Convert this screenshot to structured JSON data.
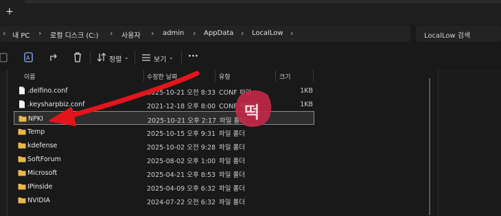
{
  "tabbar": {
    "new_tab": "+"
  },
  "address": {
    "breadcrumbs": [
      "내 PC",
      "로컬 디스크 (C:)",
      "사용자",
      "admin",
      "AppData",
      "LocalLow"
    ]
  },
  "search": {
    "placeholder": "LocalLow 검색"
  },
  "toolbar": {
    "sort_label": "정렬",
    "view_label": "보기",
    "more_label": "···"
  },
  "columns": {
    "name": "이름",
    "date": "수정한 날짜",
    "type": "유형",
    "size": "크기"
  },
  "files": [
    {
      "name": ".delfino.conf",
      "date": "2025-10-21 오전 8:33",
      "type": "CONF 파일",
      "size": "1KB",
      "kind": "file"
    },
    {
      "name": ".keysharpbiz.conf",
      "date": "2021-12-18 오후 8:00",
      "type": "CONF 파일",
      "size": "1KB",
      "kind": "file"
    },
    {
      "name": "NPKI",
      "date": "2025-10-21 오후 2:17",
      "type": "파일 폴더",
      "size": "",
      "kind": "folder",
      "selected": true
    },
    {
      "name": "Temp",
      "date": "2025-10-15 오후 9:31",
      "type": "파일 폴더",
      "size": "",
      "kind": "folder"
    },
    {
      "name": "kdefense",
      "date": "2025-10-02 오전 9:28",
      "type": "파일 폴더",
      "size": "",
      "kind": "folder"
    },
    {
      "name": "SoftForum",
      "date": "2025-08-02 오후 1:00",
      "type": "파일 폴더",
      "size": "",
      "kind": "folder"
    },
    {
      "name": "Microsoft",
      "date": "2025-04-21 오후 8:53",
      "type": "파일 폴더",
      "size": "",
      "kind": "folder"
    },
    {
      "name": "IPinside",
      "date": "2025-04-09 오후 6:32",
      "type": "파일 폴더",
      "size": "",
      "kind": "folder"
    },
    {
      "name": "NVIDIA",
      "date": "2024-07-22 오전 6:32",
      "type": "파일 폴더",
      "size": "",
      "kind": "folder"
    }
  ],
  "watermark": "떡",
  "colors": {
    "folder": "#e8b84a",
    "arrow": "#e4141b",
    "stamp": "#c7284a"
  }
}
